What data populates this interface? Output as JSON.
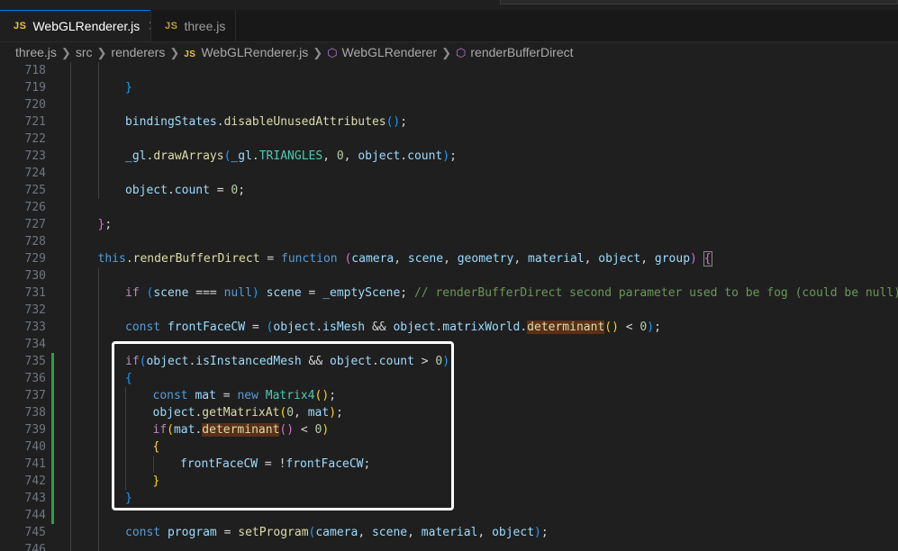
{
  "tabs": [
    {
      "icon": "JS",
      "label": "WebGLRenderer.js",
      "active": true,
      "close": "✕"
    },
    {
      "icon": "JS",
      "label": "three.js",
      "active": false
    }
  ],
  "breadcrumb": {
    "items": [
      "three.js",
      "src",
      "renderers"
    ],
    "file_icon": "JS",
    "file": "WebGLRenderer.js",
    "symbol_class": "WebGLRenderer",
    "symbol_method": "renderBufferDirect"
  },
  "editor": {
    "line_numbers": [
      "718",
      "719",
      "720",
      "721",
      "722",
      "723",
      "724",
      "725",
      "726",
      "727",
      "728",
      "729",
      "730",
      "731",
      "732",
      "733",
      "734",
      "735",
      "736",
      "737",
      "738",
      "739",
      "740",
      "741",
      "742",
      "743",
      "744",
      "745",
      "746"
    ]
  },
  "colors": {
    "background": "#1f1f1f",
    "keyword": "#569cd6",
    "function": "#dcdcaa",
    "variable": "#9cdcfe",
    "number": "#b5cea8",
    "comment": "#6a9955",
    "class": "#4ec9b0",
    "bracket_gold": "#ffd700",
    "git_added": "#2ea043",
    "highlight_box": "#ffffff"
  }
}
